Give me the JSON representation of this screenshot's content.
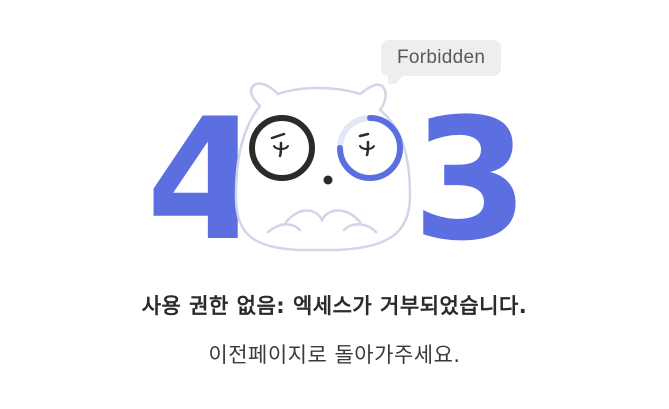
{
  "error": {
    "code_left": "4",
    "code_right": "3",
    "status_label": "Forbidden"
  },
  "message": {
    "headline": "사용 권한 없음: 엑세스가 거부되었습니다.",
    "subline": "이전페이지로 돌아가주세요."
  },
  "colors": {
    "accent": "#5b6fe0",
    "bubble_bg": "#eeeeef",
    "mascot_outline": "#cfd6e8"
  }
}
